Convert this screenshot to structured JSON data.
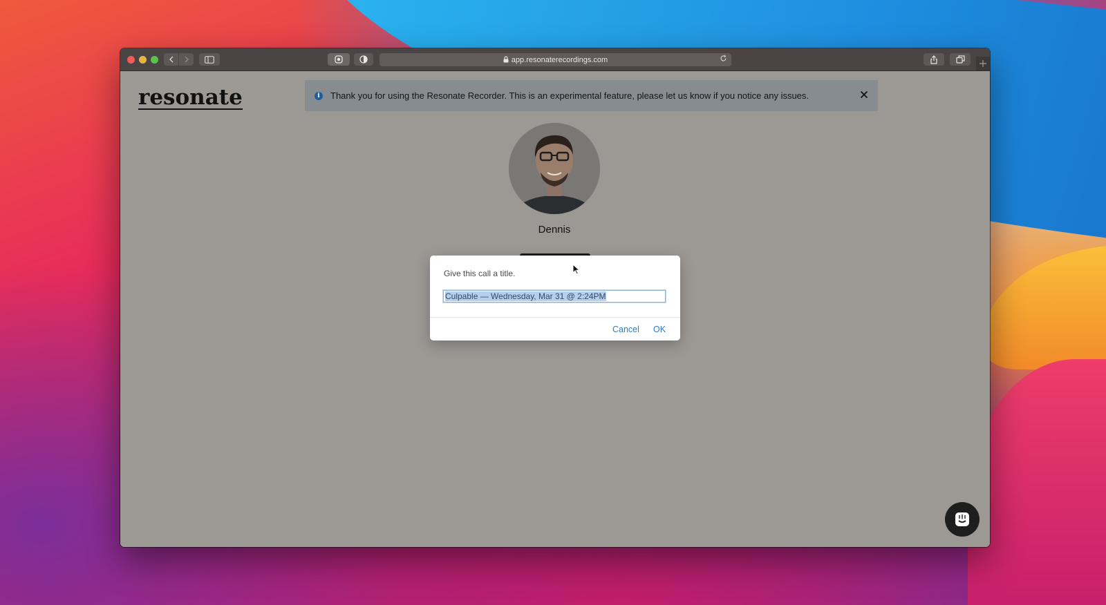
{
  "browser": {
    "url": "app.resonaterecordings.com"
  },
  "logo_text": "resonate",
  "banner": {
    "message": "Thank you for using the Resonate Recorder. This is an experimental feature, please let us know if you notice any issues.",
    "close_label": "✕"
  },
  "profile": {
    "name": "Dennis"
  },
  "dialog": {
    "message": "Give this call a title.",
    "input_value": "Culpable — Wednesday, Mar 31 @ 2:24PM",
    "cancel_label": "Cancel",
    "ok_label": "OK"
  },
  "icons": {
    "info": "info-icon",
    "close": "close-icon",
    "chat": "chat-icon"
  },
  "colors": {
    "overlay": "#9c9994",
    "banner": "#868c8f",
    "link": "#2b7cc4",
    "chat_button": "#1e1e1e"
  }
}
